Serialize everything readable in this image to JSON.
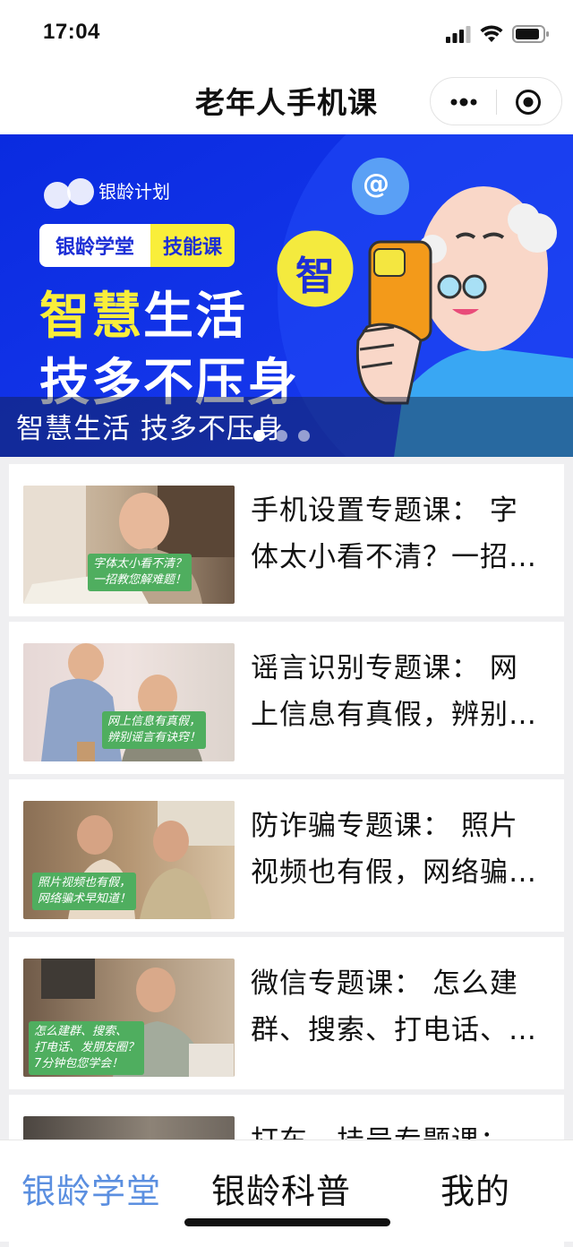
{
  "status_bar": {
    "time": "17:04"
  },
  "nav": {
    "title": "老年人手机课",
    "more_icon": "more-dots-icon",
    "close_icon": "target-circle-icon"
  },
  "banner": {
    "brand": "银龄计划",
    "tag_left": "银龄学堂",
    "tag_right": "技能课",
    "headline_yellow": "智慧",
    "headline_white": "生活",
    "headline_line2": "技多不压身",
    "badge_char": "智",
    "at_symbol": "@",
    "caption": "智慧生活 技多不压身",
    "slide_count": 3,
    "active_slide": 1,
    "colors": {
      "background": "#0c2ee0",
      "yellow": "#f9ee3a"
    }
  },
  "courses": [
    {
      "title": "手机设置专题课： 字体太小看不清？一招教您解难题！",
      "thumb_caption": "字体太小看不清？\n一招教您解难题！"
    },
    {
      "title": "谣言识别专题课： 网上信息有真假，辨别谣言有诀窍！",
      "thumb_caption": "网上信息有真假，\n辨别谣言有诀窍！"
    },
    {
      "title": "防诈骗专题课： 照片视频也有假，网络骗术早知道！",
      "thumb_caption": "照片视频也有假，\n网络骗术早知道！"
    },
    {
      "title": "微信专题课： 怎么建群、搜索、打电话、发朋友圈？",
      "thumb_caption": "怎么建群、搜索、\n打电话、发朋友圈？\n7分钟包您学会！"
    },
    {
      "title": "打车、挂号专题课：",
      "thumb_caption": ""
    }
  ],
  "tabs": [
    {
      "label": "银龄学堂",
      "active": true
    },
    {
      "label": "银龄科普",
      "active": false
    },
    {
      "label": "我的",
      "active": false
    }
  ],
  "colors": {
    "tab_active": "#5b8fe0"
  }
}
